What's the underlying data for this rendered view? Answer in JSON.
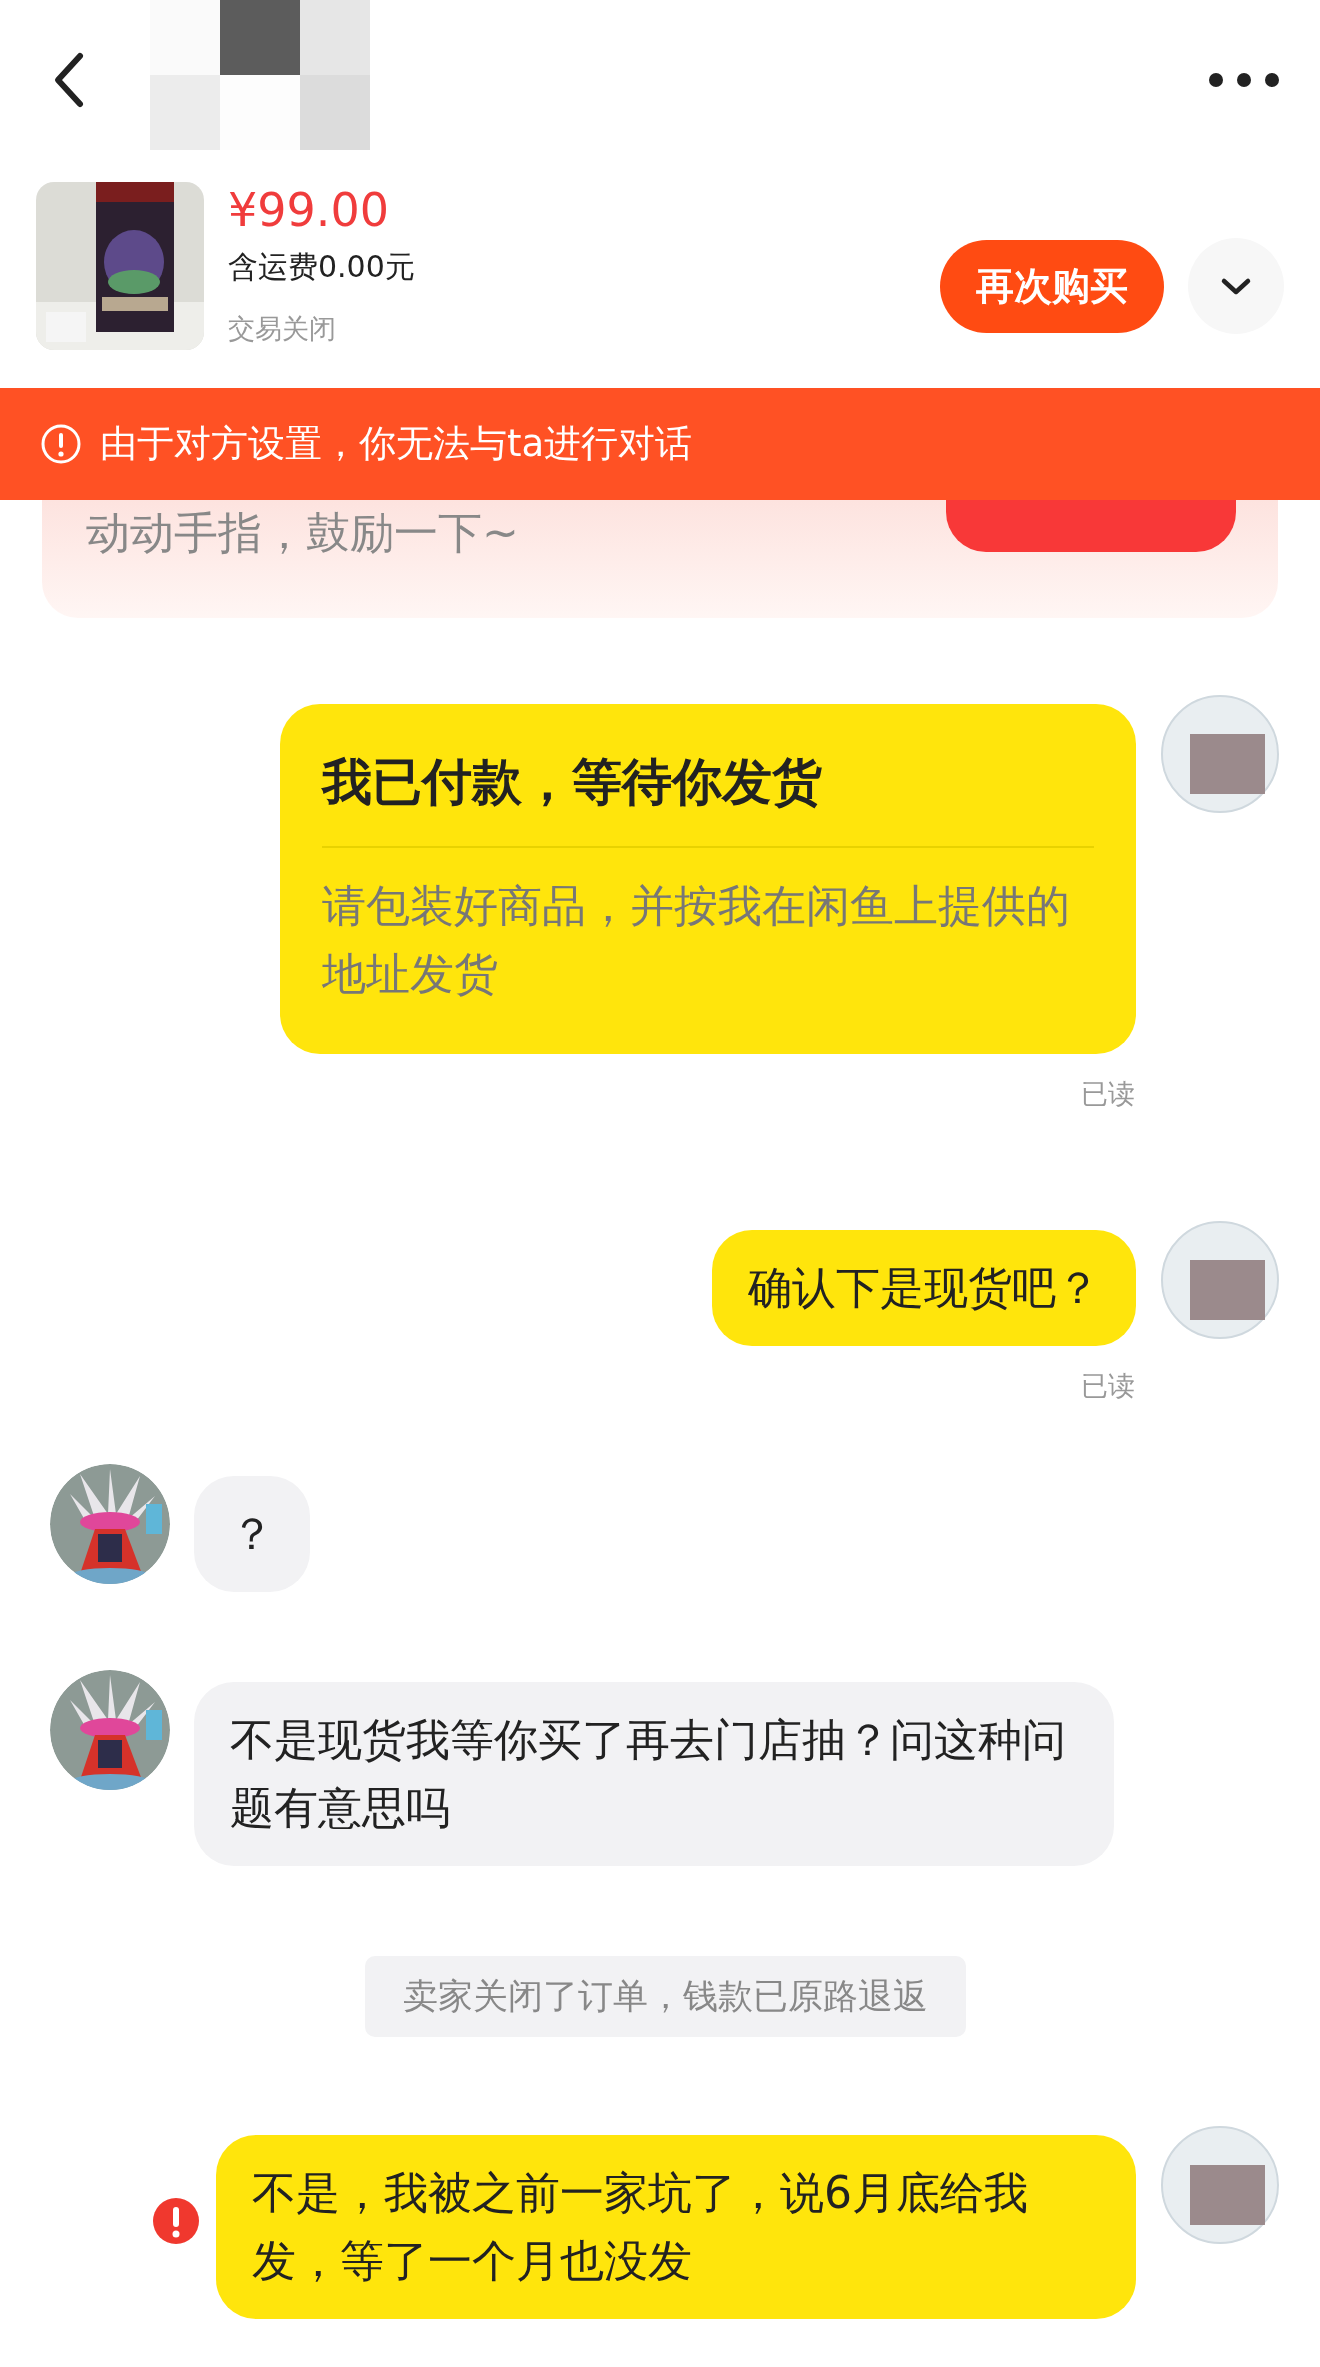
{
  "product": {
    "price": "¥99.00",
    "shipping": "含运费0.00元",
    "status": "交易关闭",
    "action": "再次购买"
  },
  "banner": {
    "text": "由于对方设置，你无法与ta进行对话"
  },
  "encourage": {
    "text": "动动手指，鼓励一下~"
  },
  "messages": [
    {
      "kind": "card",
      "outgoing": true,
      "title": "我已付款，等待你发货",
      "body": "请包装好商品，并按我在闲鱼上提供的地址发货",
      "read": "已读",
      "error": false
    },
    {
      "kind": "text",
      "outgoing": true,
      "text": "确认下是现货吧？",
      "read": "已读",
      "error": false
    },
    {
      "kind": "text",
      "outgoing": false,
      "text": "？",
      "error": false
    },
    {
      "kind": "text",
      "outgoing": false,
      "text": "不是现货我等你买了再去门店抽？问这种问题有意思吗",
      "error": false
    },
    {
      "kind": "system",
      "text": "卖家关闭了订单，钱款已原路退返"
    },
    {
      "kind": "text",
      "outgoing": true,
      "text": "不是，我被之前一家坑了，说6月底给我发，等了一个月也没发",
      "error": true
    }
  ]
}
